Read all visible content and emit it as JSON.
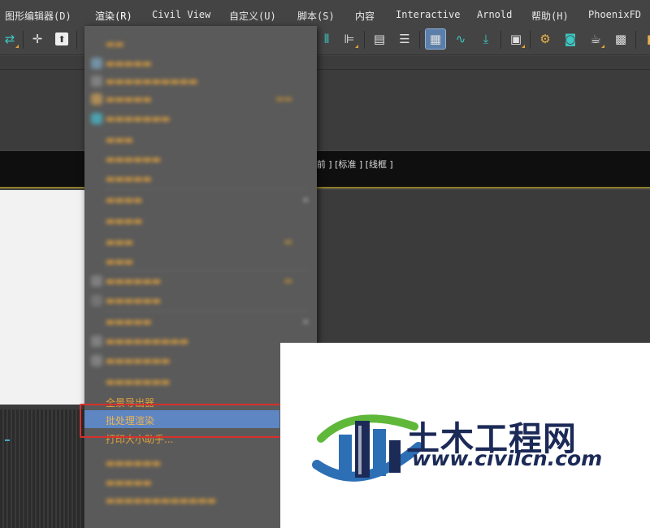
{
  "menubar": {
    "items": [
      {
        "label": "图形编辑器(D)",
        "active": false
      },
      {
        "label": "渲染(R)",
        "active": true
      },
      {
        "label": "Civil View",
        "active": false
      },
      {
        "label": "自定义(U)",
        "active": false
      },
      {
        "label": "脚本(S)",
        "active": false
      },
      {
        "label": "内容",
        "active": false
      },
      {
        "label": "Interactive",
        "active": false
      },
      {
        "label": "Arnold",
        "active": false
      },
      {
        "label": "帮助(H)",
        "active": false
      },
      {
        "label": "PhoenixFD",
        "active": false
      }
    ]
  },
  "toolbar": {
    "icons": [
      "link-icon",
      "move-icon",
      "upload-icon",
      "mirror-icon",
      "align-icon",
      "layer-list-icon",
      "stack-icon",
      "ribbon-toggle-icon",
      "curve-editor-icon",
      "schematic-icon",
      "material-editor-icon",
      "render-setup-icon",
      "rendered-frame-icon",
      "render-teapot-icon",
      "render-iterative-icon",
      "grid-icon"
    ]
  },
  "viewport": {
    "label": "[ 前 ] [标准 ] [线框 ]"
  },
  "render_menu": {
    "visible_items": [
      {
        "label": "批处理渲染",
        "highlighted": true
      },
      {
        "label": "打印大小助手...",
        "highlighted": false
      }
    ],
    "partial_item": "全景导出器"
  },
  "watermark": {
    "title": "土木工程网",
    "url": "www.civilcn.com",
    "colors": {
      "navy": "#1b2a57",
      "blue": "#2c6fb4",
      "green": "#5fb83a"
    }
  }
}
